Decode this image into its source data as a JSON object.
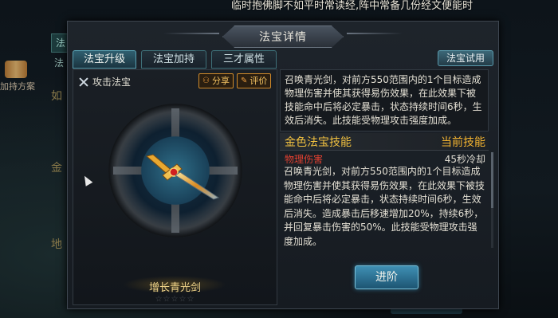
{
  "ticker_text": "临时抱佛脚不如平时常读经,阵中常备几份经文便能时",
  "background": {
    "left_tab_char": "法",
    "left_text_1": "法",
    "scroll_label": "加持方案",
    "side_chars": [
      "如",
      "金",
      "地"
    ]
  },
  "dialog": {
    "title": "法宝详情",
    "tabs": [
      {
        "label": "法宝升级",
        "active": true
      },
      {
        "label": "法宝加持",
        "active": false
      },
      {
        "label": "三才属性",
        "active": false
      }
    ],
    "try_button": "法宝试用"
  },
  "left": {
    "skill_label": "攻击法宝",
    "share_label": "分享",
    "rate_label": "评价",
    "item_name": "增长青光剑",
    "stars": "☆☆☆☆☆"
  },
  "right": {
    "description": "召唤青光剑，对前方550范围内的1个目标造成物理伤害并使其获得易伤效果，在此效果下被技能命中后将必定暴击，状态持续时间6秒，生效后消失。此技能受物理攻击强度加成。",
    "gold_skill_title": "金色法宝技能",
    "current_skill_label": "当前技能",
    "damage_type": "物理伤害",
    "cooldown": "45秒冷却",
    "skill_description": "召唤青光剑，对前方550范围内的1个目标造成物理伤害并使其获得易伤效果，在此效果下被技能命中后将必定暴击，状态持续时间6秒，生效后消失。造成暴击后移速增加20%，持续6秒，并回复暴击伤害的50%。此技能受物理攻击强度加成。",
    "advance_button": "进阶"
  },
  "colors": {
    "gold": "#f0c040",
    "damage_red": "#e04030",
    "tab_active": "#2f5f70"
  }
}
